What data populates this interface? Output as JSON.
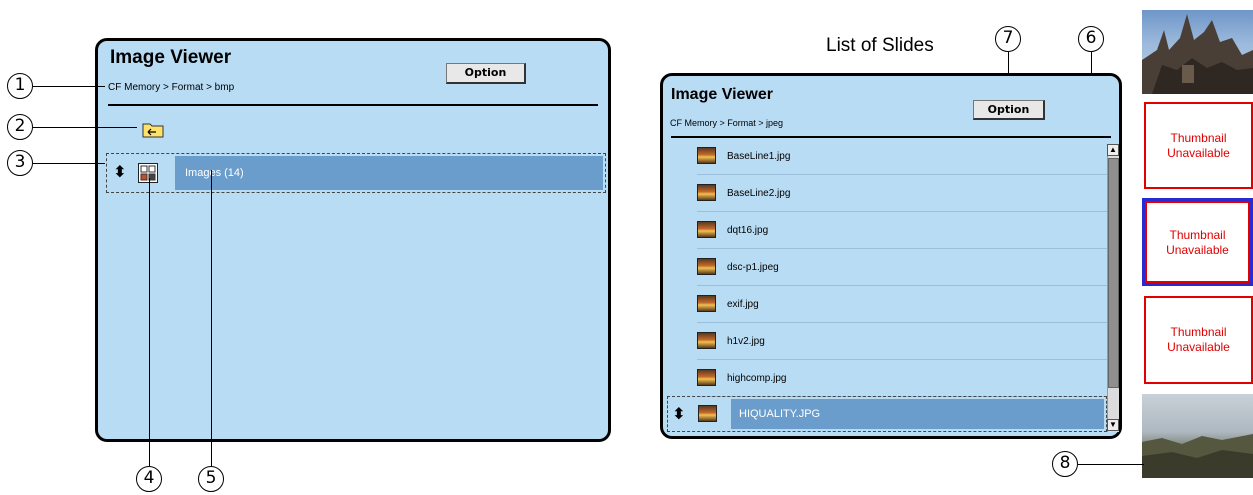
{
  "left_panel": {
    "title": "Image Viewer",
    "breadcrumb": "CF Memory > Format > bmp",
    "option_label": "Option",
    "selected_item": "Images (14)"
  },
  "right_panel": {
    "caption": "List of Slides",
    "title": "Image Viewer",
    "breadcrumb": "CF Memory > Format > jpeg",
    "option_label": "Option",
    "files": [
      "BaseLine1.jpg",
      "BaseLine2.jpg",
      "dqt16.jpg",
      "dsc-p1.jpeg",
      "exif.jpg",
      "h1v2.jpg",
      "highcomp.jpg"
    ],
    "selected_file": "HIQUALITY.JPG"
  },
  "thumbnails": {
    "unavailable_text": "Thumbnail Unavailable",
    "items": [
      "photo-cathedral",
      "unavailable",
      "unavailable-active",
      "unavailable",
      "photo-cityscape"
    ]
  },
  "callouts": {
    "c1": "1",
    "c2": "2",
    "c3": "3",
    "c4": "4",
    "c5": "5",
    "c6": "6",
    "c7": "7",
    "c8": "8"
  },
  "colors": {
    "panel_bg": "#b9dcf5",
    "selection": "#6a9dcc",
    "thumb_border": "#e00000",
    "active_border": "#2a2ad0"
  }
}
